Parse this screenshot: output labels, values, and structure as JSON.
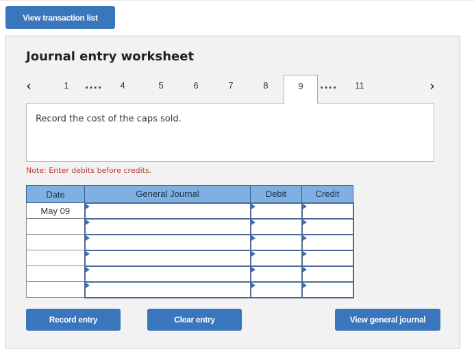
{
  "top": {
    "view_transaction_list": "View transaction list"
  },
  "worksheet": {
    "title": "Journal entry worksheet",
    "nav": {
      "prev_icon": "chevron-left-icon",
      "next_icon": "chevron-right-icon",
      "pages": [
        "1",
        "4",
        "5",
        "6",
        "7",
        "8",
        "9",
        "11"
      ],
      "ellipsis": "....",
      "active_page": "9"
    },
    "description": "Record the cost of the caps sold.",
    "note": "Note: Enter debits before credits.",
    "table": {
      "headers": {
        "date": "Date",
        "general_journal": "General Journal",
        "debit": "Debit",
        "credit": "Credit"
      },
      "rows": [
        {
          "date": "May 09",
          "account": "",
          "debit": "",
          "credit": ""
        },
        {
          "date": "",
          "account": "",
          "debit": "",
          "credit": ""
        },
        {
          "date": "",
          "account": "",
          "debit": "",
          "credit": ""
        },
        {
          "date": "",
          "account": "",
          "debit": "",
          "credit": ""
        },
        {
          "date": "",
          "account": "",
          "debit": "",
          "credit": ""
        },
        {
          "date": "",
          "account": "",
          "debit": "",
          "credit": ""
        }
      ]
    },
    "buttons": {
      "record_entry": "Record entry",
      "clear_entry": "Clear entry",
      "view_general_journal": "View general journal"
    }
  },
  "colors": {
    "button_blue": "#3a76bb",
    "header_blue": "#7fb0e3",
    "note_red": "#c0392b"
  }
}
